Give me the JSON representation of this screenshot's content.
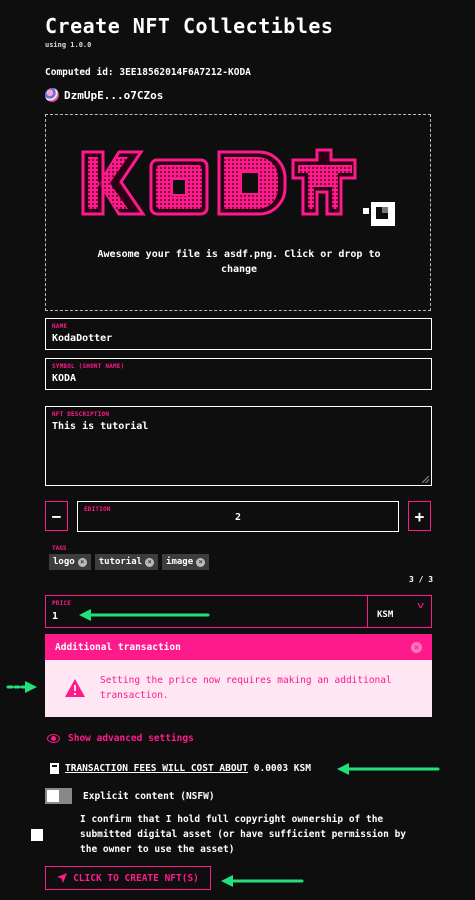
{
  "header": {
    "title": "Create NFT Collectibles",
    "version": "using 1.0.0",
    "computed_id": "Computed id: 3EE18562014F6A7212-KODA",
    "owner": "DzmUpE...o7CZos"
  },
  "upload": {
    "logo_text": "KODA",
    "message": "Awesome your file is asdf.png. Click or drop to change"
  },
  "form": {
    "name_label": "NAME",
    "name_value": "KodaDotter",
    "symbol_label": "SYMBOL (SHORT NAME)",
    "symbol_value": "KODA",
    "description_label": "NFT DESCRIPTION",
    "description_value": "This is tutorial",
    "edition_label": "EDITION",
    "edition_value": "2",
    "minus_label": "−",
    "plus_label": "+",
    "tags_label": "TAGS",
    "tags": [
      "logo",
      "tutorial",
      "image"
    ],
    "tags_count": "3 / 3",
    "price_label": "PRICE",
    "price_value": "1",
    "currency": "KSM"
  },
  "notice": {
    "title": "Additional transaction",
    "message": "Setting the price now requires making an additional transaction."
  },
  "advanced_label": "Show advanced settings",
  "fees": {
    "label": "TRANSACTION FEES WILL COST ABOUT",
    "amount": " 0.0003 KSM"
  },
  "nsfw_label": "Explicit content (NSFW)",
  "confirm_label": "I confirm that I hold full copyright ownership of the submitted digital asset (or have sufficient permission by the owner to use the asset)",
  "create_label": "CLICK TO CREATE NFT(S)",
  "colors": {
    "accent": "#ff1a8c",
    "background": "#0e0e0e",
    "annotation_arrow": "#22e07a",
    "notice_bg": "#ffe6f3"
  },
  "toggles": {
    "nsfw": false,
    "confirm": true
  }
}
